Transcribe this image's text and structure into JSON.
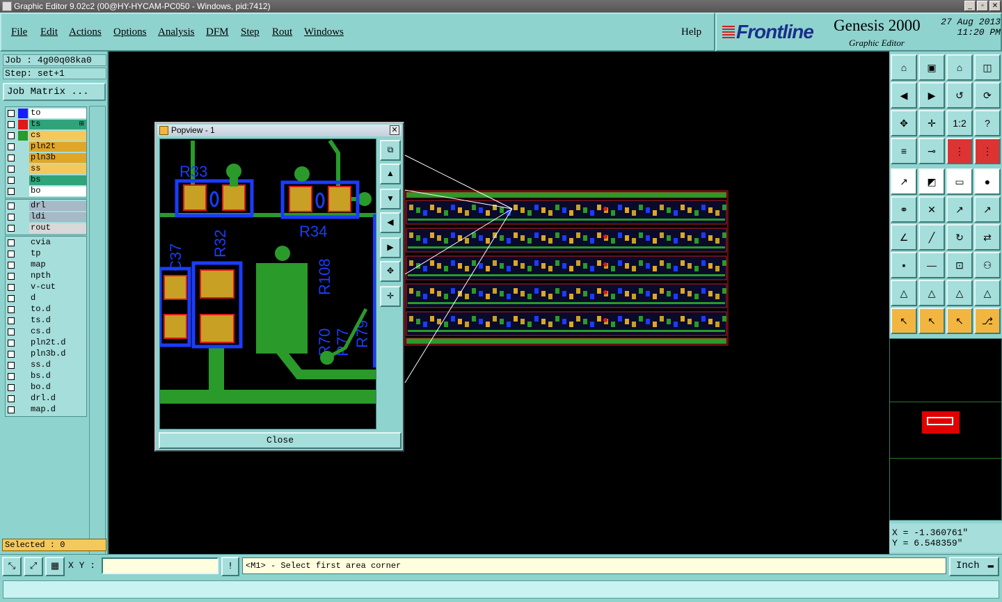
{
  "window": {
    "title": "Graphic Editor 9.02c2 (00@HY-HYCAM-PC050 - Windows, pid:7412)"
  },
  "menu": {
    "items": [
      "File",
      "Edit",
      "Actions",
      "Options",
      "Analysis",
      "DFM",
      "Step",
      "Rout",
      "Windows"
    ],
    "help": "Help"
  },
  "brand": {
    "logo": "Frontline",
    "product": "Genesis 2000",
    "subtitle": "Graphic Editor",
    "date": "27 Aug 2013",
    "time": "11:20 PM"
  },
  "job": {
    "job_label": "Job : 4g00q08ka0",
    "step_label": "Step: set+1",
    "matrix_button": "Job Matrix ..."
  },
  "layers": {
    "board": [
      {
        "name": "to",
        "color": "#ffffff",
        "swatch": "#1a1aff"
      },
      {
        "name": "ts",
        "color": "#2fa37a",
        "swatch": "#e01818"
      },
      {
        "name": "cs",
        "color": "#f5c85c",
        "swatch": "#2a9a2a"
      },
      {
        "name": "pln2t",
        "color": "#e0a628",
        "swatch": ""
      },
      {
        "name": "pln3b",
        "color": "#e0a628",
        "swatch": ""
      },
      {
        "name": "ss",
        "color": "#f5c85c",
        "swatch": ""
      },
      {
        "name": "bs",
        "color": "#2fa37a",
        "swatch": ""
      },
      {
        "name": "bo",
        "color": "#ffffff",
        "swatch": ""
      }
    ],
    "drill": [
      {
        "name": "drl",
        "color": "#a6b9c6"
      },
      {
        "name": "ldi",
        "color": "#a6b9c6"
      },
      {
        "name": "rout",
        "color": "#d8d8d8"
      }
    ],
    "misc": [
      "cvia",
      "tp",
      "map",
      "npth",
      "v-cut",
      "d",
      "to.d",
      "ts.d",
      "cs.d",
      "pln2t.d",
      "pln3b.d",
      "ss.d",
      "bs.d",
      "bo.d",
      "drl.d",
      "map.d"
    ]
  },
  "selected": "Selected : 0",
  "popview": {
    "title": "Popview - 1",
    "close_label": "Close",
    "refdes": [
      "R33",
      "R34",
      "C37",
      "R32",
      "R108",
      "R70",
      "R77",
      "R79"
    ]
  },
  "coords": {
    "x": "X = -1.360761\"",
    "y": "Y = 6.548359\""
  },
  "bottom": {
    "xy_label": "X Y :",
    "xy_value": "",
    "prompt": "<M1> - Select first area corner",
    "units": "Inch"
  }
}
